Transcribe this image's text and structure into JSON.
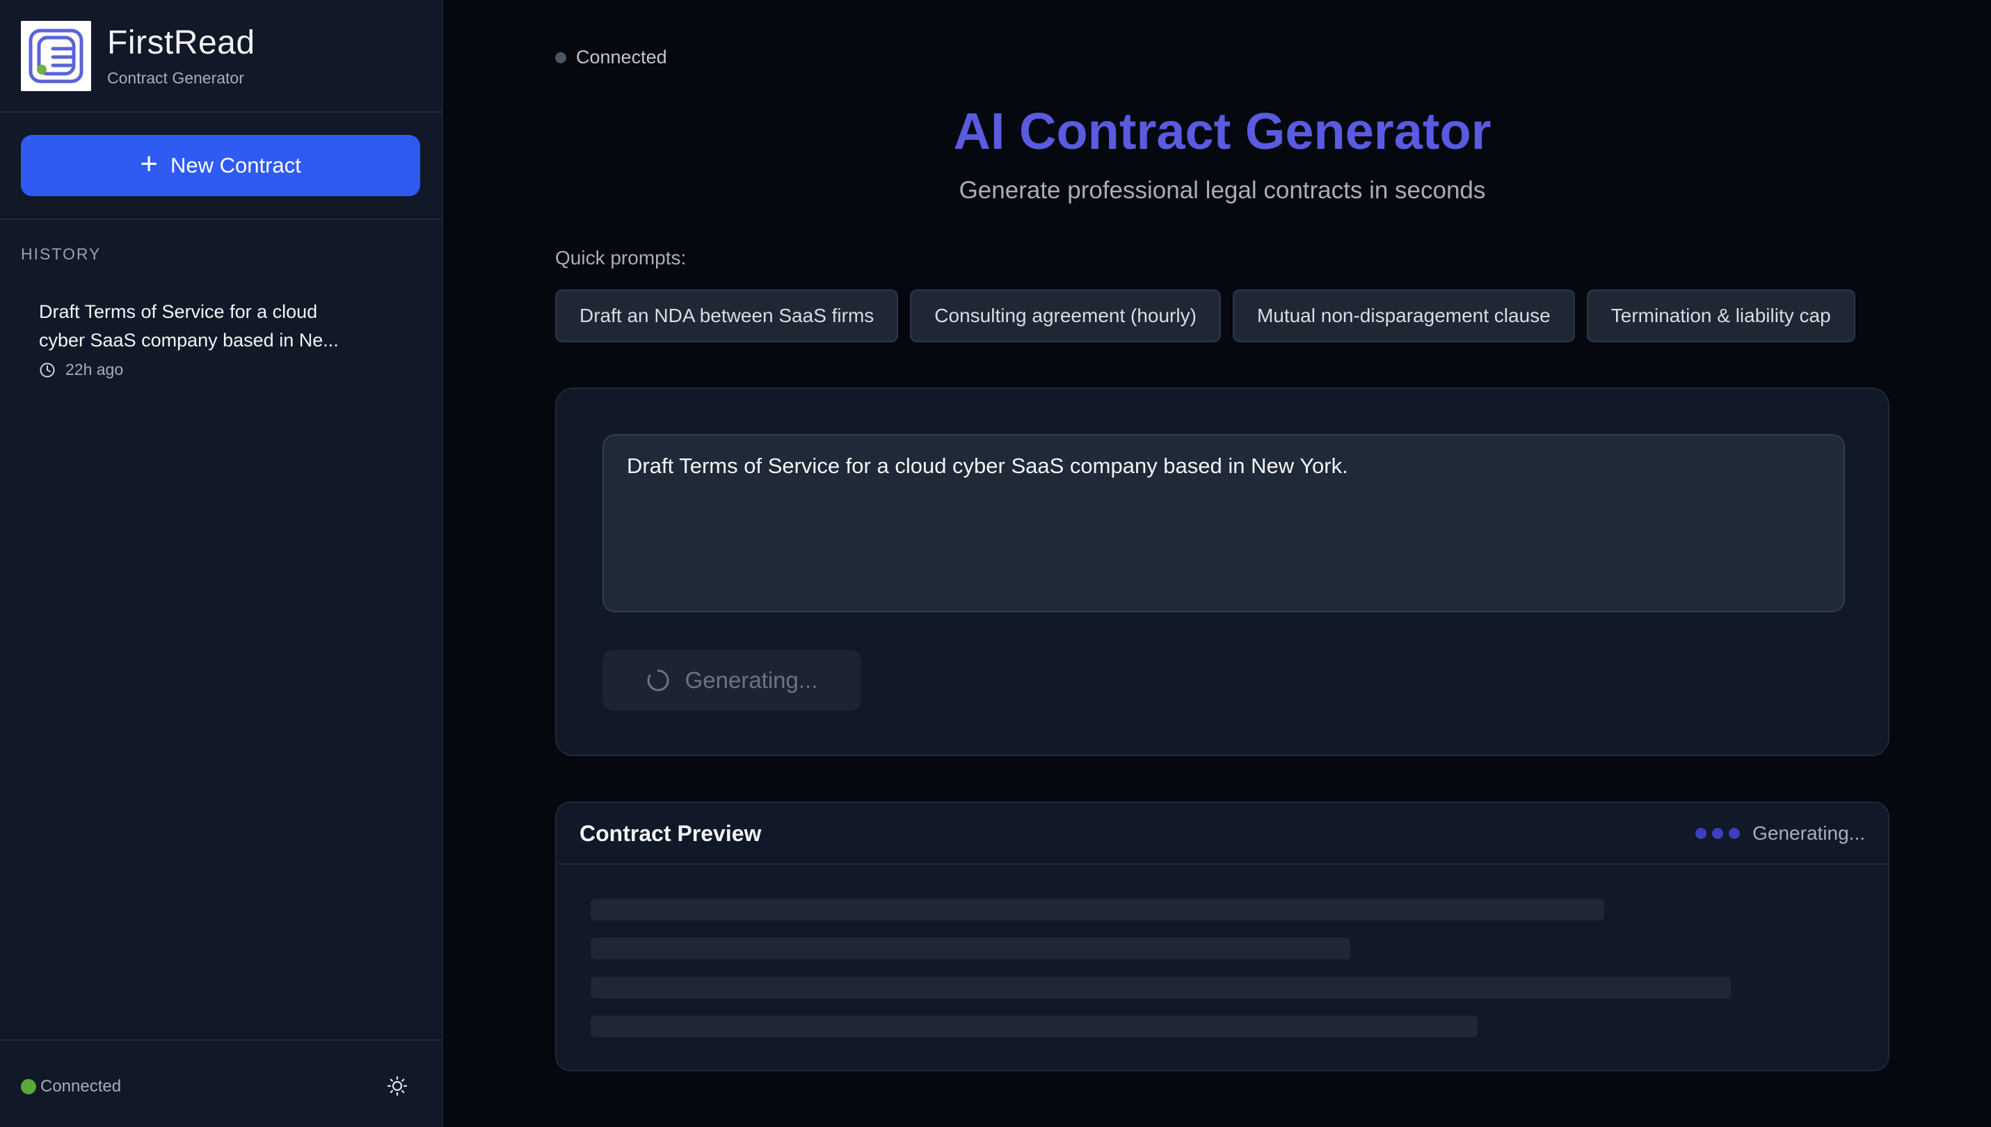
{
  "sidebar": {
    "brand_name": "FirstRead",
    "brand_sub": "Contract Generator",
    "new_contract_label": "New Contract",
    "history_label": "HISTORY",
    "history_items": [
      {
        "title": "Draft Terms of Service for a cloud cyber SaaS company based in Ne...",
        "time": "22h ago"
      }
    ],
    "footer_status": "Connected",
    "icons": {
      "new": "plus-icon",
      "time": "clock-icon",
      "theme": "sun-icon"
    }
  },
  "main": {
    "connection_status": "Connected",
    "title": "AI Contract Generator",
    "subtitle": "Generate professional legal contracts in seconds",
    "quick_prompts_label": "Quick prompts:",
    "quick_prompts": [
      "Draft an NDA between SaaS firms",
      "Consulting agreement (hourly)",
      "Mutual non-disparagement clause",
      "Termination & liability cap"
    ],
    "prompt_value": "Draft Terms of Service for a cloud cyber SaaS company based in New York.",
    "generate_button_label": "Generating...",
    "preview": {
      "title": "Contract Preview",
      "status": "Generating..."
    }
  },
  "colors": {
    "accent": "#2f5bf3",
    "title": "#5a5be0",
    "connected": "#5aa93a",
    "background": "#05080f",
    "sidebar": "#111827"
  }
}
